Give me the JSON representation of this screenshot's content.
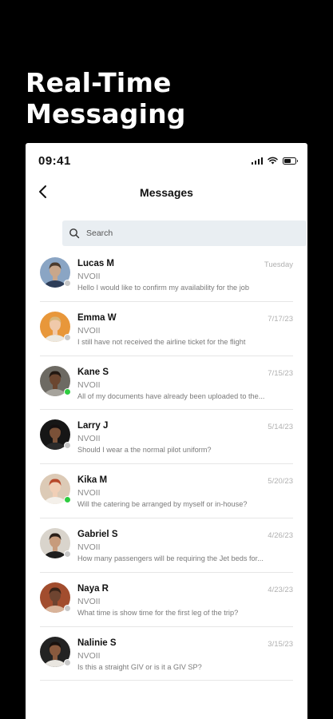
{
  "headline": "Real-Time Messaging",
  "status_bar": {
    "time": "09:41"
  },
  "nav": {
    "back_icon": "chevron-left-icon",
    "title": "Messages"
  },
  "search": {
    "placeholder": "Search",
    "icon": "search-icon"
  },
  "colors": {
    "online": "#2ecc40",
    "offline": "#c8c8c8",
    "search_bg": "#e9eef2"
  },
  "conversations": [
    {
      "name": "Lucas M",
      "company": "NVOII",
      "preview": "Hello I would like to confirm my availability for the job",
      "date": "Tuesday",
      "online": false,
      "avatar_bg": "#8aa5c4",
      "skin": "#c9a78b",
      "hair": "#4a3a2d",
      "shirt": "#2d3d58"
    },
    {
      "name": "Emma W",
      "company": "NVOII",
      "preview": "I still have not received the airline ticket for the flight",
      "date": "7/17/23",
      "online": false,
      "avatar_bg": "#e8973a",
      "skin": "#f0c9aa",
      "hair": "#d8b67a",
      "shirt": "#ece8e0"
    },
    {
      "name": "Kane S",
      "company": "NVOII",
      "preview": "All of my documents have already been uploaded to the...",
      "date": "7/15/23",
      "online": true,
      "avatar_bg": "#6d6a63",
      "skin": "#6b4630",
      "hair": "#221812",
      "shirt": "#a6a39c"
    },
    {
      "name": "Larry J",
      "company": "NVOII",
      "preview": "Should I wear a the normal pilot uniform?",
      "date": "5/14/23",
      "online": false,
      "avatar_bg": "#161616",
      "skin": "#7a5138",
      "hair": "#151010",
      "shirt": "#2b2b2b"
    },
    {
      "name": "Kika M",
      "company": "NVOII",
      "preview": "Will the catering be arranged by myself or in-house?",
      "date": "5/20/23",
      "online": true,
      "avatar_bg": "#dccab6",
      "skin": "#f1cfb6",
      "hair": "#b8482a",
      "shirt": "#f4f0ea"
    },
    {
      "name": "Gabriel S",
      "company": "NVOII",
      "preview": "How many passengers will be requiring the Jet beds for...",
      "date": "4/26/23",
      "online": false,
      "avatar_bg": "#d9d4cc",
      "skin": "#c79b7c",
      "hair": "#2a1f19",
      "shirt": "#1e1e1e"
    },
    {
      "name": "Naya R",
      "company": "NVOII",
      "preview": "What time is show time for the first leg of the trip?",
      "date": "4/23/23",
      "online": false,
      "avatar_bg": "#a24d2e",
      "skin": "#6e4430",
      "hair": "#3a2418",
      "shirt": "#d9b49a"
    },
    {
      "name": "Nalinie S",
      "company": "NVOII",
      "preview": "Is this a straight GIV or is it a GIV SP?",
      "date": "3/15/23",
      "online": false,
      "avatar_bg": "#232323",
      "skin": "#8a5a3e",
      "hair": "#1a120e",
      "shirt": "#e9e6e0"
    }
  ]
}
